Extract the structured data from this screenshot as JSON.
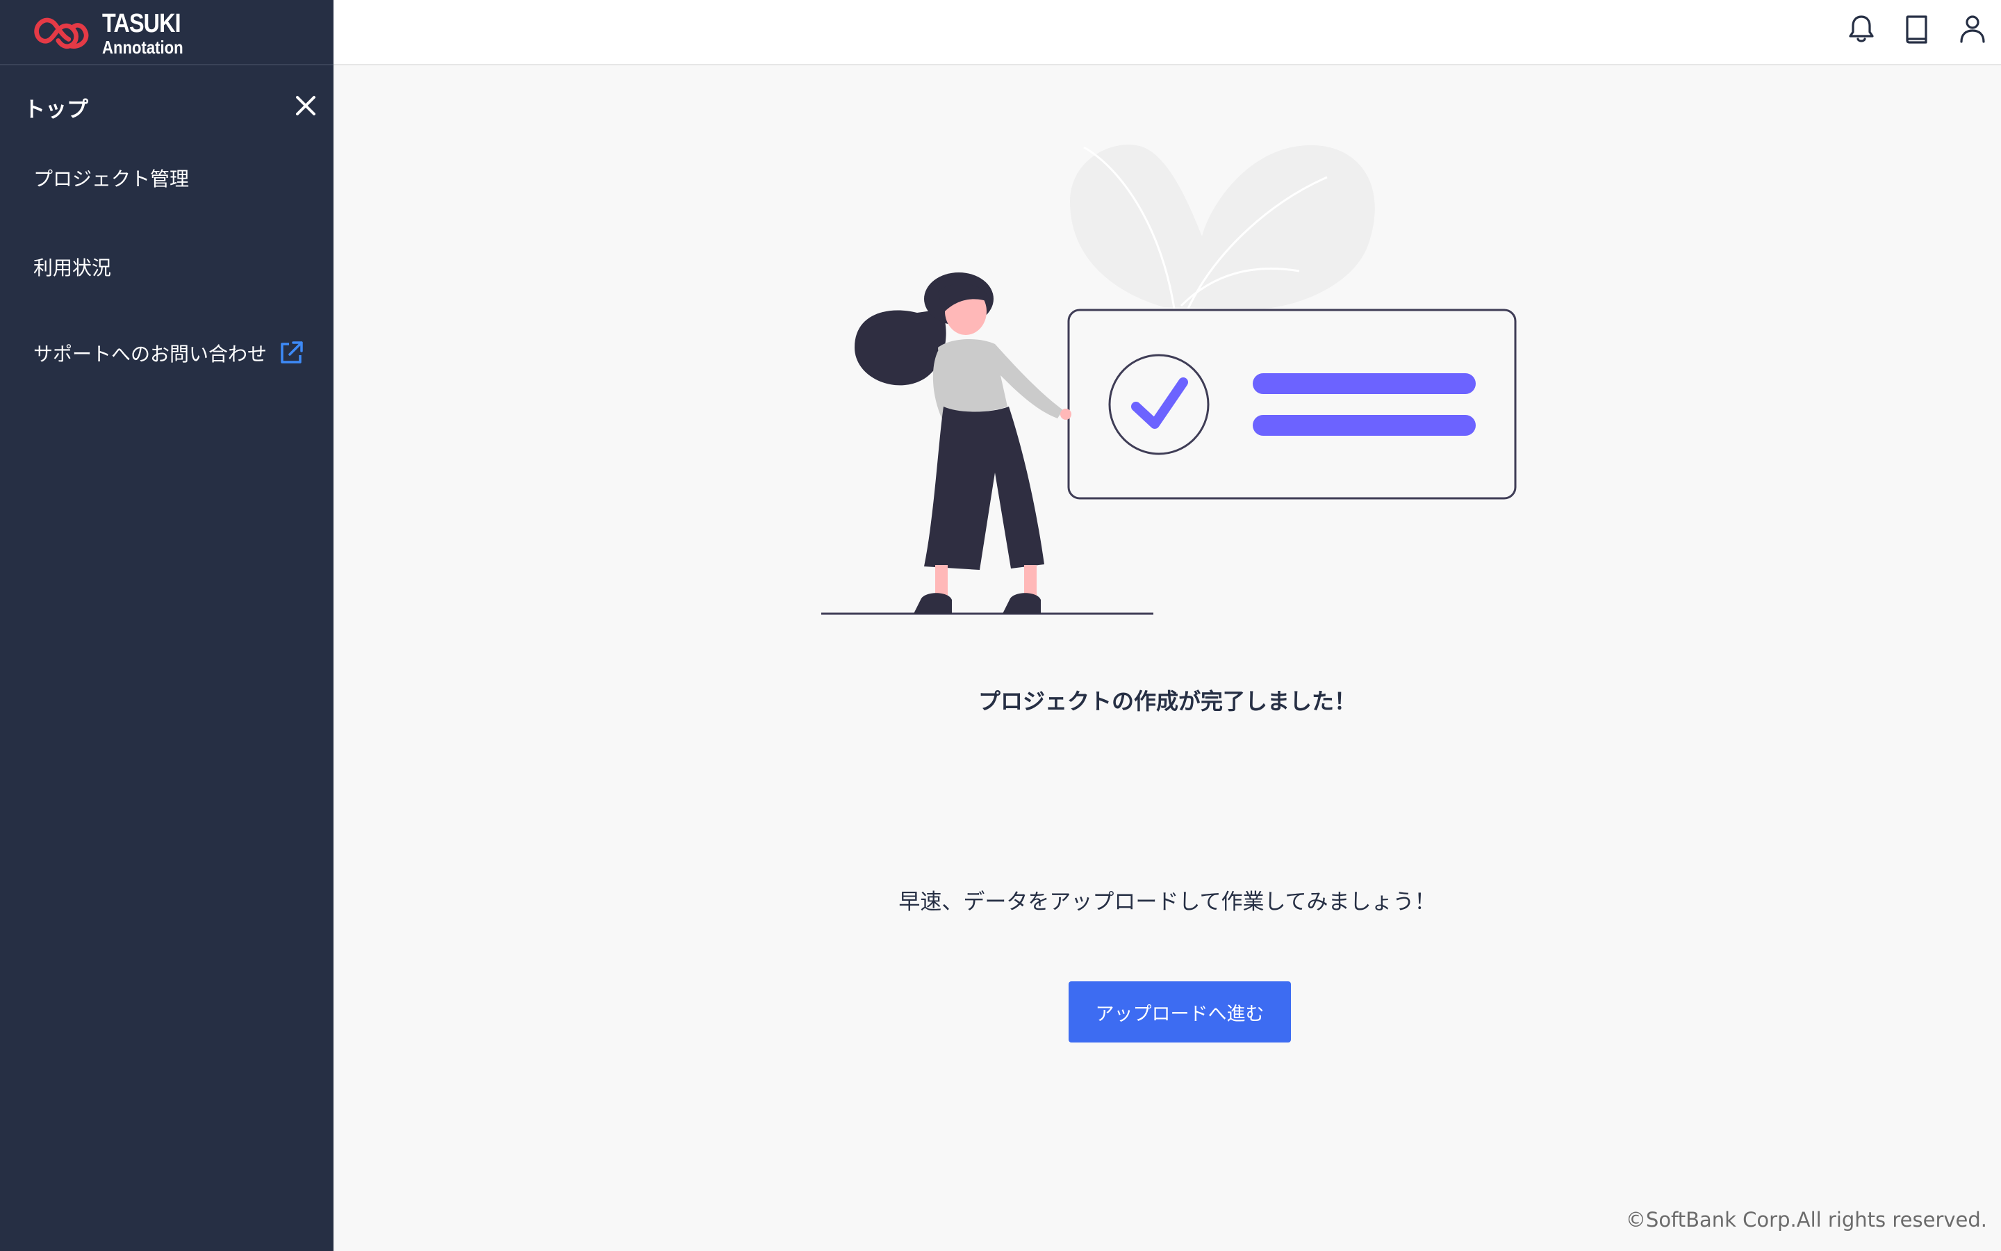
{
  "app": {
    "logo_main": "TASUKI",
    "logo_sub": "Annotation"
  },
  "sidebar": {
    "title": "トップ",
    "close_icon": "close-icon",
    "items": [
      {
        "label": "プロジェクト管理"
      },
      {
        "label": "利用状況"
      },
      {
        "label": "サポートへのお問い合わせ",
        "icon": "external-link-icon"
      }
    ]
  },
  "header": {
    "icons": [
      "bell-icon",
      "book-icon",
      "user-icon"
    ]
  },
  "main": {
    "headline": "プロジェクトの作成が完了しました！",
    "message": "早速、データをアップロードして作業してみましょう！",
    "button_label": "アップロードへ進む"
  },
  "footer": {
    "copyright": "©SoftBank Corp.All rights reserved."
  },
  "colors": {
    "sidebar_bg": "#262f44",
    "primary": "#3d6cf2",
    "accent_purple": "#6c63ff",
    "logo_red": "#e53a46",
    "page_bg": "#f8f8f8"
  }
}
